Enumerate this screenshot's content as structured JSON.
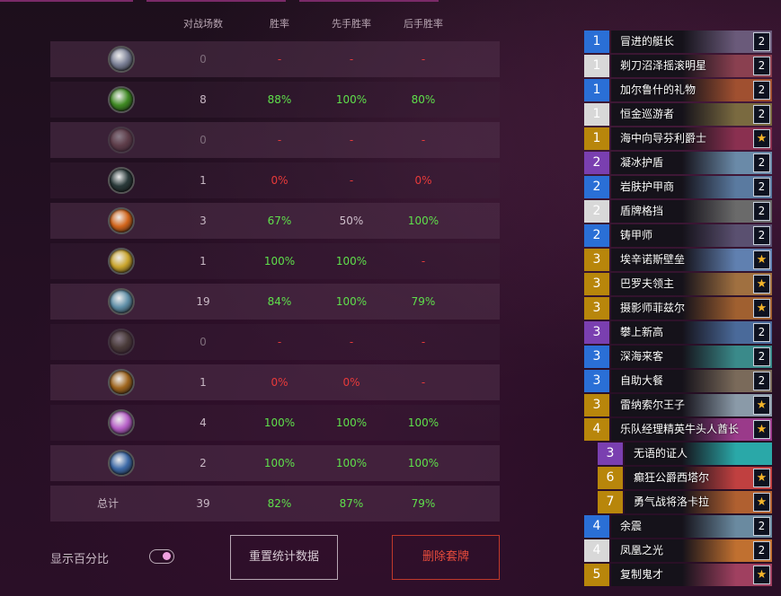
{
  "headers": {
    "games": "对战场数",
    "winrate": "胜率",
    "first": "先手胜率",
    "second": "后手胜率"
  },
  "rows": [
    {
      "class_icon": "demon-hunter-icon",
      "color": "#7a7f95",
      "faded": false,
      "games": "0",
      "winrate": "-",
      "first": "-",
      "second": "-",
      "wr_color": "r",
      "first_color": "r",
      "second_color": "r",
      "games_dim": true
    },
    {
      "class_icon": "druid-icon",
      "color": "#3f8a23",
      "faded": false,
      "games": "8",
      "winrate": "88%",
      "first": "100%",
      "second": "80%",
      "wr_color": "g",
      "first_color": "g",
      "second_color": "g",
      "games_dim": false
    },
    {
      "class_icon": "hunter-icon",
      "color": "#8a6060",
      "faded": true,
      "games": "0",
      "winrate": "-",
      "first": "-",
      "second": "-",
      "wr_color": "r",
      "first_color": "r",
      "second_color": "r",
      "games_dim": true
    },
    {
      "class_icon": "death-knight-icon",
      "color": "#2a3a3a",
      "faded": false,
      "games": "1",
      "winrate": "0%",
      "first": "-",
      "second": "0%",
      "wr_color": "r",
      "first_color": "r",
      "second_color": "r",
      "games_dim": false
    },
    {
      "class_icon": "mage-icon",
      "color": "#d2651b",
      "faded": false,
      "games": "3",
      "winrate": "67%",
      "first": "50%",
      "second": "100%",
      "wr_color": "g",
      "first_color": "n",
      "second_color": "g",
      "games_dim": false
    },
    {
      "class_icon": "paladin-icon",
      "color": "#caa52c",
      "faded": false,
      "games": "1",
      "winrate": "100%",
      "first": "100%",
      "second": "-",
      "wr_color": "g",
      "first_color": "g",
      "second_color": "r",
      "games_dim": false
    },
    {
      "class_icon": "priest-icon",
      "color": "#5f8fa8",
      "faded": false,
      "games": "19",
      "winrate": "84%",
      "first": "100%",
      "second": "79%",
      "wr_color": "g",
      "first_color": "g",
      "second_color": "g",
      "games_dim": false
    },
    {
      "class_icon": "rogue-icon",
      "color": "#6a6a4a",
      "faded": true,
      "games": "0",
      "winrate": "-",
      "first": "-",
      "second": "-",
      "wr_color": "r",
      "first_color": "r",
      "second_color": "r",
      "games_dim": true
    },
    {
      "class_icon": "shaman-icon",
      "color": "#a0661e",
      "faded": false,
      "games": "1",
      "winrate": "0%",
      "first": "0%",
      "second": "-",
      "wr_color": "r",
      "first_color": "r",
      "second_color": "r",
      "games_dim": false
    },
    {
      "class_icon": "warlock-icon",
      "color": "#b65fc7",
      "faded": false,
      "games": "4",
      "winrate": "100%",
      "first": "100%",
      "second": "100%",
      "wr_color": "g",
      "first_color": "g",
      "second_color": "g",
      "games_dim": false
    },
    {
      "class_icon": "warrior-icon",
      "color": "#3d6aa8",
      "faded": false,
      "games": "2",
      "winrate": "100%",
      "first": "100%",
      "second": "100%",
      "wr_color": "g",
      "first_color": "g",
      "second_color": "g",
      "games_dim": false
    }
  ],
  "total": {
    "label": "总计",
    "games": "39",
    "winrate": "82%",
    "first": "87%",
    "second": "79%"
  },
  "toggle": {
    "label": "显示百分比",
    "on": true
  },
  "buttons": {
    "reset": "重置统计数据",
    "delete": "删除套牌"
  },
  "cards": [
    {
      "cost": "1",
      "rarity": "#2a6fd6",
      "name": "冒进的艇长",
      "count": "2",
      "legendary": false,
      "art": "#6a5a7a",
      "indent": 0
    },
    {
      "cost": "1",
      "rarity": "#d8d8d8",
      "name": "剃刀沼泽摇滚明星",
      "count": "2",
      "legendary": false,
      "art": "#8a4050",
      "indent": 0
    },
    {
      "cost": "1",
      "rarity": "#2a6fd6",
      "name": "加尔鲁什的礼物",
      "count": "2",
      "legendary": false,
      "art": "#a05030",
      "indent": 0
    },
    {
      "cost": "1",
      "rarity": "#d8d8d8",
      "name": "恒金巡游者",
      "count": "2",
      "legendary": false,
      "art": "#7a6a40",
      "indent": 0
    },
    {
      "cost": "1",
      "rarity": "#b8860b",
      "name": "海中向导芬利爵士",
      "count": "★",
      "legendary": true,
      "art": "#8a3050",
      "indent": 0
    },
    {
      "cost": "2",
      "rarity": "#7a3fb0",
      "name": "凝冰护盾",
      "count": "2",
      "legendary": false,
      "art": "#6a8aa8",
      "indent": 0
    },
    {
      "cost": "2",
      "rarity": "#2a6fd6",
      "name": "岩肤护甲商",
      "count": "2",
      "legendary": false,
      "art": "#5a7aa0",
      "indent": 0
    },
    {
      "cost": "2",
      "rarity": "#d8d8d8",
      "name": "盾牌格挡",
      "count": "2",
      "legendary": false,
      "art": "#6a6a6a",
      "indent": 0
    },
    {
      "cost": "2",
      "rarity": "#2a6fd6",
      "name": "铸甲师",
      "count": "2",
      "legendary": false,
      "art": "#5a5070",
      "indent": 0
    },
    {
      "cost": "3",
      "rarity": "#b8860b",
      "name": "埃辛诺斯壁垒",
      "count": "★",
      "legendary": true,
      "art": "#6080b0",
      "indent": 0
    },
    {
      "cost": "3",
      "rarity": "#b8860b",
      "name": "巴罗夫领主",
      "count": "★",
      "legendary": true,
      "art": "#a07040",
      "indent": 0
    },
    {
      "cost": "3",
      "rarity": "#b8860b",
      "name": "摄影师菲兹尔",
      "count": "★",
      "legendary": true,
      "art": "#a06030",
      "indent": 0
    },
    {
      "cost": "3",
      "rarity": "#7a3fb0",
      "name": "攀上新高",
      "count": "2",
      "legendary": false,
      "art": "#4a6a9a",
      "indent": 0
    },
    {
      "cost": "3",
      "rarity": "#2a6fd6",
      "name": "深海来客",
      "count": "2",
      "legendary": false,
      "art": "#3a8a8a",
      "indent": 0
    },
    {
      "cost": "3",
      "rarity": "#2a6fd6",
      "name": "自助大餐",
      "count": "2",
      "legendary": false,
      "art": "#7a6a5a",
      "indent": 0
    },
    {
      "cost": "3",
      "rarity": "#b8860b",
      "name": "雷纳索尔王子",
      "count": "★",
      "legendary": true,
      "art": "#8a9aa8",
      "indent": 0
    },
    {
      "cost": "4",
      "rarity": "#b8860b",
      "name": "乐队经理精英牛头人酋长",
      "count": "★",
      "legendary": true,
      "art": "#9a3a8a",
      "indent": 0
    },
    {
      "cost": "3",
      "rarity": "#7a3fb0",
      "name": "无语的证人",
      "count": "",
      "legendary": false,
      "art": "#2aa8a8",
      "indent": 1
    },
    {
      "cost": "6",
      "rarity": "#b8860b",
      "name": "癫狂公爵西塔尔",
      "count": "★",
      "legendary": true,
      "art": "#c04040",
      "indent": 1
    },
    {
      "cost": "7",
      "rarity": "#b8860b",
      "name": "勇气战将洛卡拉",
      "count": "★",
      "legendary": true,
      "art": "#b06030",
      "indent": 1
    },
    {
      "cost": "4",
      "rarity": "#2a6fd6",
      "name": "余震",
      "count": "2",
      "legendary": false,
      "art": "#6a8aa0",
      "indent": 0
    },
    {
      "cost": "4",
      "rarity": "#d8d8d8",
      "name": "凤凰之光",
      "count": "2",
      "legendary": false,
      "art": "#c07030",
      "indent": 0
    },
    {
      "cost": "5",
      "rarity": "#b8860b",
      "name": "复制鬼才",
      "count": "★",
      "legendary": true,
      "art": "#a04060",
      "indent": 0
    }
  ]
}
